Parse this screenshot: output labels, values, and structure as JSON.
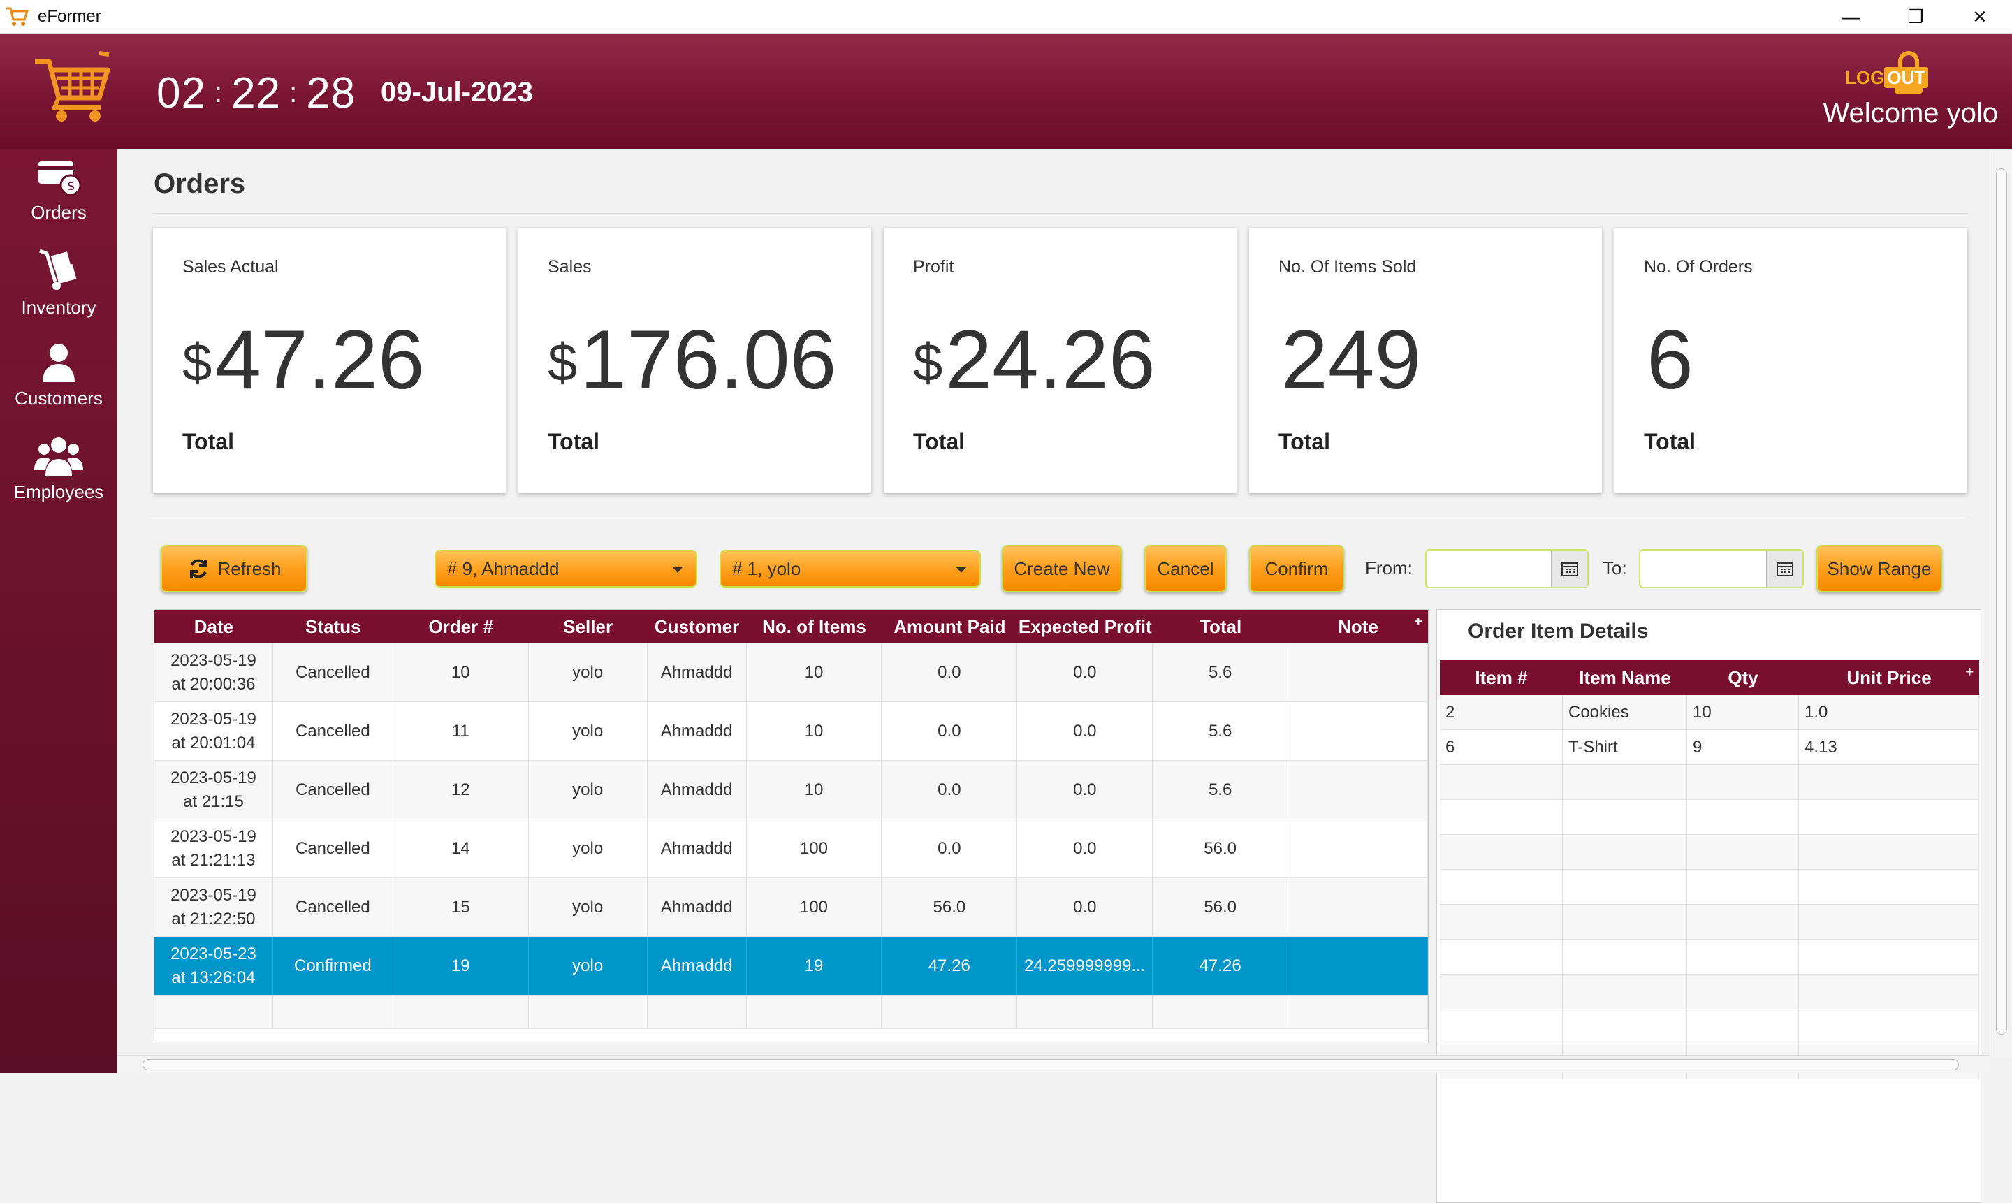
{
  "window": {
    "title": "eFormer",
    "minimize": "—",
    "restore": "❐",
    "close": "✕"
  },
  "header": {
    "clock": {
      "hh": "02",
      "mm": "22",
      "ss": "28"
    },
    "date": "09-Jul-2023",
    "logout_log": "LOG",
    "logout_out": "OUT",
    "welcome": "Welcome yolo"
  },
  "sidebar": {
    "items": [
      {
        "label": "Orders",
        "icon": "orders-icon"
      },
      {
        "label": "Inventory",
        "icon": "inventory-icon"
      },
      {
        "label": "Customers",
        "icon": "customer-icon"
      },
      {
        "label": "Employees",
        "icon": "employees-icon"
      }
    ]
  },
  "page": {
    "title": "Orders"
  },
  "cards": [
    {
      "label": "Sales Actual",
      "currency": "$",
      "value": "47.26",
      "foot": "Total"
    },
    {
      "label": "Sales",
      "currency": "$",
      "value": "176.06",
      "foot": "Total"
    },
    {
      "label": "Profit",
      "currency": "$",
      "value": "24.26",
      "foot": "Total"
    },
    {
      "label": "No. Of Items Sold",
      "currency": "",
      "value": "249",
      "foot": "Total"
    },
    {
      "label": "No. Of Orders",
      "currency": "",
      "value": "6",
      "foot": "Total"
    }
  ],
  "toolbar": {
    "refresh": "Refresh",
    "customer_combo": "# 9, Ahmaddd",
    "seller_combo": "# 1, yolo",
    "create_new": "Create New",
    "cancel": "Cancel",
    "confirm": "Confirm",
    "from_label": "From:",
    "to_label": "To:",
    "from_value": "",
    "to_value": "",
    "show_range": "Show Range"
  },
  "orders_table": {
    "columns": [
      "Date",
      "Status",
      "Order #",
      "Seller",
      "Customer",
      "No. of Items",
      "Amount Paid",
      "Expected Profit",
      "Total",
      "Note"
    ],
    "rows": [
      {
        "date1": "2023-05-19",
        "date2": "at 20:00:36",
        "status": "Cancelled",
        "order": "10",
        "seller": "yolo",
        "customer": "Ahmaddd",
        "items": "10",
        "paid": "0.0",
        "profit": "0.0",
        "total": "5.6",
        "note": ""
      },
      {
        "date1": "2023-05-19",
        "date2": "at 20:01:04",
        "status": "Cancelled",
        "order": "11",
        "seller": "yolo",
        "customer": "Ahmaddd",
        "items": "10",
        "paid": "0.0",
        "profit": "0.0",
        "total": "5.6",
        "note": ""
      },
      {
        "date1": "2023-05-19",
        "date2": "at 21:15",
        "status": "Cancelled",
        "order": "12",
        "seller": "yolo",
        "customer": "Ahmaddd",
        "items": "10",
        "paid": "0.0",
        "profit": "0.0",
        "total": "5.6",
        "note": ""
      },
      {
        "date1": "2023-05-19",
        "date2": "at 21:21:13",
        "status": "Cancelled",
        "order": "14",
        "seller": "yolo",
        "customer": "Ahmaddd",
        "items": "100",
        "paid": "0.0",
        "profit": "0.0",
        "total": "56.0",
        "note": ""
      },
      {
        "date1": "2023-05-19",
        "date2": "at 21:22:50",
        "status": "Cancelled",
        "order": "15",
        "seller": "yolo",
        "customer": "Ahmaddd",
        "items": "100",
        "paid": "56.0",
        "profit": "0.0",
        "total": "56.0",
        "note": ""
      },
      {
        "date1": "2023-05-23",
        "date2": "at 13:26:04",
        "status": "Confirmed",
        "order": "19",
        "seller": "yolo",
        "customer": "Ahmaddd",
        "items": "19",
        "paid": "47.26",
        "profit": "24.259999999...",
        "total": "47.26",
        "note": ""
      }
    ]
  },
  "details": {
    "title": "Order Item Details",
    "columns": [
      "Item #",
      "Item Name",
      "Qty",
      "Unit Price"
    ],
    "rows": [
      {
        "item": "2",
        "name": "Cookies",
        "qty": "10",
        "price": "1.0"
      },
      {
        "item": "6",
        "name": "T-Shirt",
        "qty": "9",
        "price": "4.13"
      }
    ]
  },
  "colors": {
    "brand": "#7a1634",
    "header_row": "#7a0e2e",
    "accent": "#ff9f1c",
    "selected": "#0096c9"
  }
}
